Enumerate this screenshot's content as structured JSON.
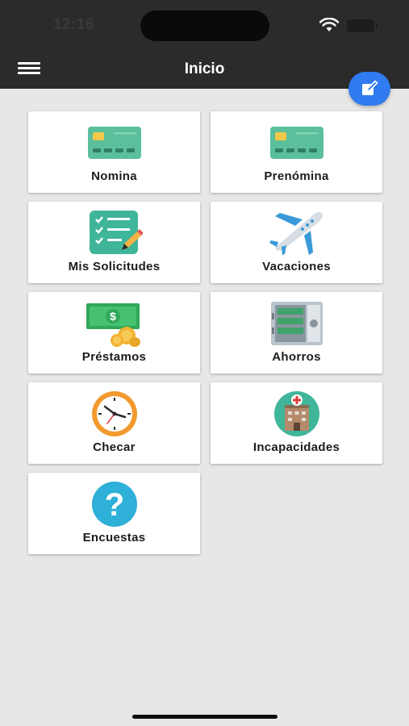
{
  "status_bar": {
    "time": "12:16"
  },
  "header": {
    "title": "Inicio"
  },
  "tiles": [
    {
      "label": "Nomina",
      "icon": "credit-card-icon"
    },
    {
      "label": "Prenómina",
      "icon": "credit-card-icon"
    },
    {
      "label": "Mis Solicitudes",
      "icon": "checklist-icon"
    },
    {
      "label": "Vacaciones",
      "icon": "airplane-icon"
    },
    {
      "label": "Préstamos",
      "icon": "money-coins-icon"
    },
    {
      "label": "Ahorros",
      "icon": "safe-icon"
    },
    {
      "label": "Checar",
      "icon": "clock-icon"
    },
    {
      "label": "Incapacidades",
      "icon": "hospital-icon"
    },
    {
      "label": "Encuestas",
      "icon": "question-icon"
    }
  ],
  "colors": {
    "header_bg": "#2b2b2b",
    "accent": "#2f7bef",
    "background": "#e7e7e7"
  }
}
